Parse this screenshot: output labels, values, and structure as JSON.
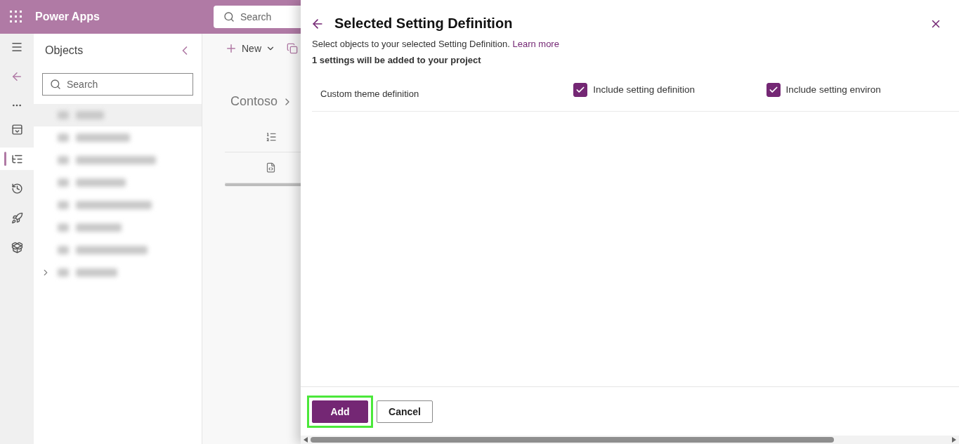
{
  "app": {
    "title": "Power Apps",
    "search_placeholder": "Search"
  },
  "rail": {
    "items": [
      {
        "kind": "page",
        "selected": false
      },
      {
        "kind": "list",
        "selected": true
      },
      {
        "kind": "history",
        "selected": false
      },
      {
        "kind": "rocket",
        "selected": false
      },
      {
        "kind": "package",
        "selected": false
      }
    ]
  },
  "objects": {
    "title": "Objects",
    "search_placeholder": "Search",
    "items": [
      {
        "selected": true,
        "expandable": false
      },
      {
        "selected": false,
        "expandable": false
      },
      {
        "selected": false,
        "expandable": false
      },
      {
        "selected": false,
        "expandable": false
      },
      {
        "selected": false,
        "expandable": false
      },
      {
        "selected": false,
        "expandable": false
      },
      {
        "selected": false,
        "expandable": false
      },
      {
        "selected": false,
        "expandable": true
      }
    ]
  },
  "toolbar": {
    "new_label": "New"
  },
  "breadcrumb": [
    "Contoso"
  ],
  "dialog": {
    "title": "Selected Setting Definition",
    "description": "Select objects to your selected Setting Definition.",
    "link": "Learn more",
    "summary": "1 settings will be added to your project",
    "rows": [
      {
        "name": "Custom theme definition",
        "options": [
          {
            "label": "Include setting definition",
            "checked": true
          },
          {
            "label": "Include setting environ",
            "checked": true
          }
        ]
      }
    ],
    "buttons": [
      {
        "label": "Add",
        "kind": "primary",
        "highlighted": true
      },
      {
        "label": "Cancel",
        "kind": "secondary",
        "highlighted": false
      }
    ]
  }
}
